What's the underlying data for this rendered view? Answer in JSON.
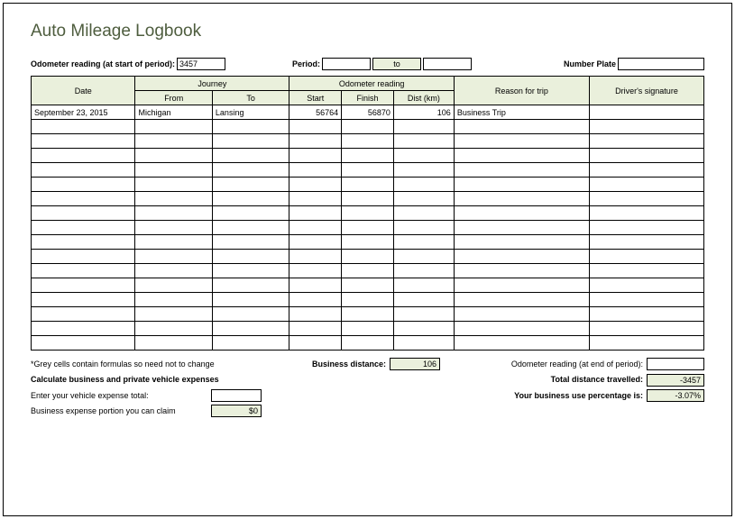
{
  "title": "Auto Mileage Logbook",
  "header": {
    "odometer_label": "Odometer reading (at start of period):",
    "odometer_start": "3457",
    "period_label": "Period:",
    "period_from": "",
    "period_to_label": "to",
    "period_to": "",
    "plate_label": "Number Plate",
    "plate": ""
  },
  "columns": {
    "date": "Date",
    "journey": "Journey",
    "from": "From",
    "to": "To",
    "odo": "Odometer reading",
    "start": "Start",
    "finish": "Finish",
    "dist": "Dist (km)",
    "reason": "Reason for trip",
    "signature": "Driver's signature"
  },
  "rows": [
    {
      "date": "September 23, 2015",
      "from": "Michigan",
      "to": "Lansing",
      "start": "56764",
      "finish": "56870",
      "dist": "106",
      "reason": "Business Trip",
      "sig": ""
    }
  ],
  "empty_row_count": 16,
  "footer": {
    "formula_note": "*Grey cells contain formulas so need not to change",
    "business_distance_label": "Business distance:",
    "business_distance": "106",
    "odo_end_label": "Odometer reading (at end of period):",
    "odo_end": "",
    "calc_heading": "Calculate business and private vehicle expenses",
    "total_travelled_label": "Total distance travelled:",
    "total_travelled": "-3457",
    "expense_total_label": "Enter your vehicle expense total:",
    "expense_total": "",
    "percentage_label": "Your business use percentage is:",
    "percentage": "-3.07%",
    "claim_label": "Business expense portion you can claim",
    "claim": "$0"
  }
}
